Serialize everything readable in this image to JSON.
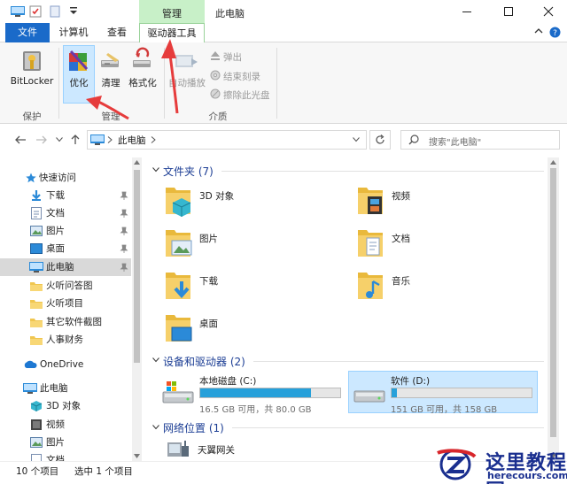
{
  "window": {
    "title": "此电脑",
    "context_tab": "管理"
  },
  "tabs": [
    {
      "label": "文件"
    },
    {
      "label": "计算机"
    },
    {
      "label": "查看"
    },
    {
      "label": "驱动器工具"
    }
  ],
  "ribbon": {
    "bitlocker": "BitLocker",
    "protect_group": "保护",
    "optimize": "优化",
    "cleanup": "清理",
    "format": "格式化",
    "manage_group": "管理",
    "autoplay": "自动播放",
    "eject": "弹出",
    "finish_burn": "结束刻录",
    "erase_disc": "擦除此光盘",
    "media_group": "介质"
  },
  "address": {
    "path": "此电脑"
  },
  "search": {
    "placeholder": "搜索\"此电脑\""
  },
  "nav": {
    "quick_access": "快速访问",
    "quick_items": [
      {
        "label": "下载",
        "pinned": true
      },
      {
        "label": "文档",
        "pinned": true
      },
      {
        "label": "图片",
        "pinned": true
      },
      {
        "label": "桌面",
        "pinned": true
      },
      {
        "label": "此电脑",
        "pinned": true
      },
      {
        "label": "火听问答图"
      },
      {
        "label": "火听项目"
      },
      {
        "label": "其它软件截图"
      },
      {
        "label": "人事财务"
      }
    ],
    "onedrive": "OneDrive",
    "this_pc": "此电脑",
    "pc_items": [
      {
        "label": "3D 对象"
      },
      {
        "label": "视频"
      },
      {
        "label": "图片"
      },
      {
        "label": "文档"
      }
    ]
  },
  "content": {
    "folders_header": "文件夹 (7)",
    "folders": [
      {
        "label": "3D 对象"
      },
      {
        "label": "视频"
      },
      {
        "label": "图片"
      },
      {
        "label": "文档"
      },
      {
        "label": "下载"
      },
      {
        "label": "音乐"
      },
      {
        "label": "桌面"
      }
    ],
    "devices_header": "设备和驱动器 (2)",
    "drives": [
      {
        "label": "本地磁盘 (C:)",
        "usage": "16.5 GB 可用，共 80.0 GB",
        "used_fraction": 0.79
      },
      {
        "label": "软件 (D:)",
        "usage": "151 GB 可用，共 158 GB",
        "used_fraction": 0.04
      }
    ],
    "network_header": "网络位置 (1)",
    "network": [
      {
        "label": "天翼网关"
      }
    ]
  },
  "status": {
    "count": "10 个项目",
    "selected": "选中 1 个项目"
  },
  "watermark": {
    "text": "这里教程网",
    "url": "herecours.com"
  },
  "colors": {
    "accent": "#1a6ac9",
    "context_tab": "#c8f0c8",
    "selection": "#cce8ff",
    "drive_bar": "#26a0da",
    "annotation_arrow": "#e63c3c"
  }
}
